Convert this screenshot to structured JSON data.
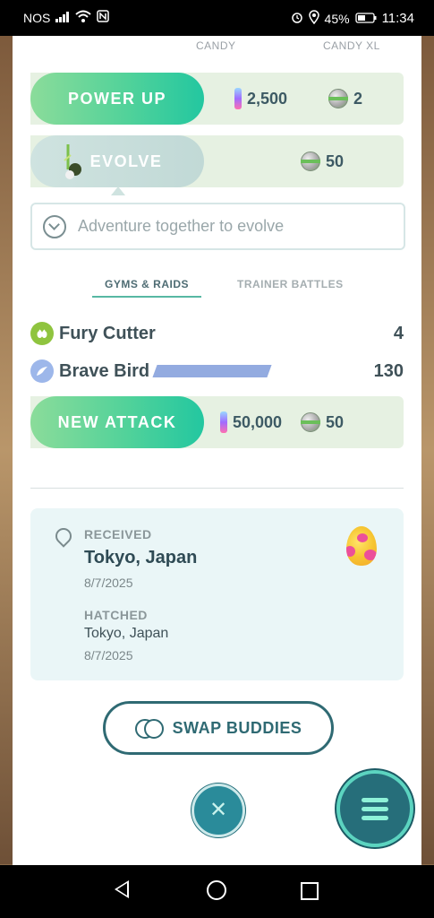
{
  "status_bar": {
    "carrier": "NOS",
    "battery": "45%",
    "time": "11:34"
  },
  "candy_header": {
    "candy_label": "CANDY",
    "candy_xl_label": "CANDY XL"
  },
  "power_up": {
    "label": "POWER UP",
    "candy_cost": "2,500",
    "xl_cost": "2"
  },
  "evolve": {
    "label": "EVOLVE",
    "xl_cost": "50",
    "hint": "Adventure together to evolve"
  },
  "tabs": [
    {
      "label": "GYMS & RAIDS",
      "active": true
    },
    {
      "label": "TRAINER BATTLES",
      "active": false
    }
  ],
  "moves": {
    "fast": {
      "name": "Fury Cutter",
      "damage": "4",
      "type_icon": "bug-type-icon"
    },
    "charged": {
      "name": "Brave Bird",
      "damage": "130",
      "type_icon": "flying-type-icon"
    }
  },
  "new_attack": {
    "label": "NEW ATTACK",
    "candy_cost": "50,000",
    "xl_cost": "50"
  },
  "origin": {
    "received_label": "RECEIVED",
    "received_location": "Tokyo, Japan",
    "received_date": "8/7/2025",
    "hatched_label": "HATCHED",
    "hatched_location": "Tokyo, Japan",
    "hatched_date": "8/7/2025"
  },
  "swap_buddies_label": "SWAP BUDDIES",
  "colors": {
    "accent_green": "#52d29a",
    "teal_dark": "#2f6a73"
  }
}
